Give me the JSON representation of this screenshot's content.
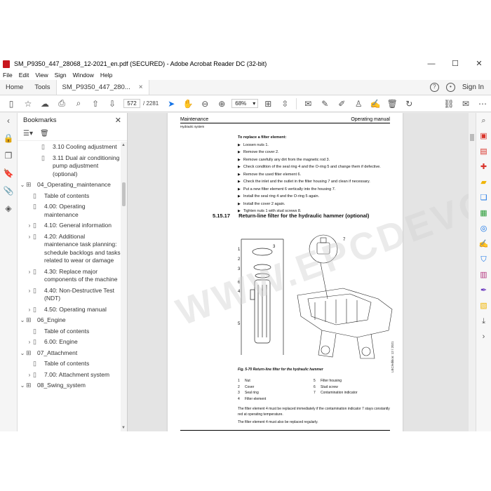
{
  "window": {
    "title": "SM_P9350_447_28068_12-2021_en.pdf (SECURED) - Adobe Acrobat Reader DC (32-bit)",
    "minimize": "—",
    "maximize": "☐",
    "close": "✕"
  },
  "menu": [
    "File",
    "Edit",
    "View",
    "Sign",
    "Window",
    "Help"
  ],
  "tabs": {
    "home": "Home",
    "tools": "Tools",
    "document": "SM_P9350_447_280...",
    "close": "×",
    "help": "?",
    "sign_in": "Sign In"
  },
  "toolbar": {
    "page_current": "572",
    "page_total": "/ 2281",
    "zoom": "68%"
  },
  "bookmarks": {
    "title": "Bookmarks",
    "close": "✕",
    "items": [
      {
        "label": "3.10 Cooling adjustment",
        "level": 2,
        "chev": ""
      },
      {
        "label": "3.11 Dual air conditioning pump adjustment (optional)",
        "level": 2,
        "chev": ""
      },
      {
        "label": "04_Operating_maintenance",
        "level": 0,
        "chev": "⌄"
      },
      {
        "label": "Table of contents",
        "level": 1,
        "chev": ""
      },
      {
        "label": "4.00: Operating maintenance",
        "level": 1,
        "chev": ""
      },
      {
        "label": "4.10: General information",
        "level": 1,
        "chev": "›"
      },
      {
        "label": "4.20: Additional maintenance task planning: schedule backlogs and tasks related to wear or damage",
        "level": 1,
        "chev": "›"
      },
      {
        "label": "4.30: Replace major components of the machine",
        "level": 1,
        "chev": "›"
      },
      {
        "label": "4.40: Non-Destructive Test (NDT)",
        "level": 1,
        "chev": "›"
      },
      {
        "label": "4.50: Operating manual",
        "level": 1,
        "chev": "›"
      },
      {
        "label": "06_Engine",
        "level": 0,
        "chev": "⌄"
      },
      {
        "label": "Table of contents",
        "level": 1,
        "chev": ""
      },
      {
        "label": "6.00: Engine",
        "level": 1,
        "chev": "›"
      },
      {
        "label": "07_Attachment",
        "level": 0,
        "chev": "⌄"
      },
      {
        "label": "Table of contents",
        "level": 1,
        "chev": ""
      },
      {
        "label": "7.00: Attachment system",
        "level": 1,
        "chev": "›"
      },
      {
        "label": "08_Swing_system",
        "level": 0,
        "chev": "⌄"
      }
    ]
  },
  "document": {
    "header_left": "Maintenance",
    "header_right": "Operating manual",
    "subheader": "Hydraulic system",
    "steps_title": "To replace a filter element:",
    "steps": [
      "Loosen nuts 1.",
      "Remove the cover 2.",
      "Remove carefully any dirt from the magnetic rod 3.",
      "Check condition of the seal ring 4 and the O-ring 5 and change them if defective.",
      "Remove the used filter element 6.",
      "Check the inlet and the outlet in the filter housing 7 and clean if necessary.",
      "Put a new filter element 6 vertically into the housing 7.",
      "Install the seal ring 4 and the O-ring 5 again.",
      "Install the cover 2 again.",
      "Tighten nuts 1 with stud screws 8."
    ],
    "section_number": "5.15.17",
    "section_title": "Return-line filter for the hydraulic hammer (optional)",
    "figure_caption": "Fig. 5-70    Return-line filter for the hydraulic hammer",
    "legend": [
      [
        "1",
        "Nut",
        "5",
        "Filter housing"
      ],
      [
        "2",
        "Cover",
        "6",
        "Stud screw"
      ],
      [
        "3",
        "Seal ring",
        "7",
        "Contamination indicator"
      ],
      [
        "4",
        "Filter element",
        "",
        ""
      ]
    ],
    "paragraph1": "The filter element 4 must be replaced immediately if the contamination indicator 7 stays constantly red at operating temperature.",
    "paragraph2": "The filter element 4 must also be replaced regularly.",
    "side_note": "LBC/edition: 12 / 2021",
    "figure_callouts": [
      "1",
      "2",
      "3",
      "6",
      "4",
      "5",
      "3",
      "7"
    ]
  },
  "watermark": "WWW.EPCDEVO.COM"
}
